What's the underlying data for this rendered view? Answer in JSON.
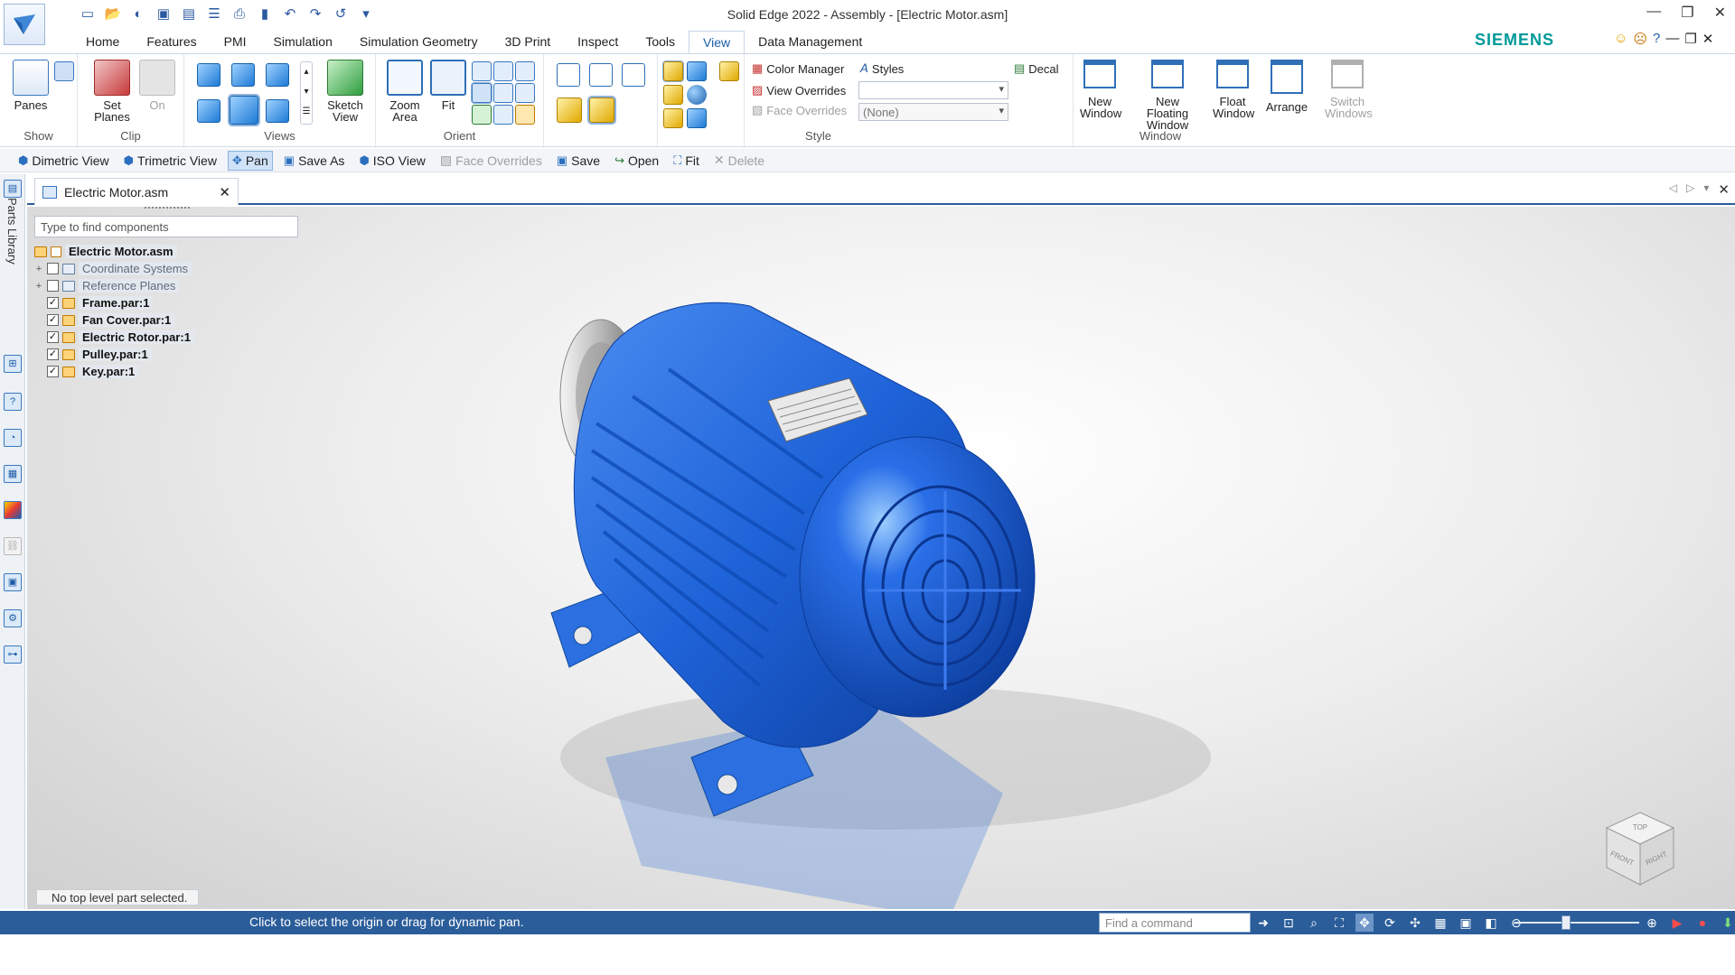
{
  "window": {
    "title": "Solid Edge 2022 - Assembly - [Electric Motor.asm]",
    "brand": "SIEMENS"
  },
  "tabs": [
    "Home",
    "Features",
    "PMI",
    "Simulation",
    "Simulation Geometry",
    "3D Print",
    "Inspect",
    "Tools",
    "View",
    "Data Management"
  ],
  "active_tab": "View",
  "ribbon": {
    "show": {
      "label": "Show",
      "panes": "Panes"
    },
    "clip": {
      "label": "Clip",
      "set_planes": "Set Planes",
      "on": "On"
    },
    "views": {
      "label": "Views",
      "sketch_view": "Sketch View"
    },
    "orient": {
      "label": "Orient",
      "zoom_area": "Zoom Area",
      "fit": "Fit"
    },
    "style": {
      "label": "Style",
      "color_manager": "Color Manager",
      "styles": "Styles",
      "view_overrides": "View Overrides",
      "face_overrides": "Face Overrides",
      "face_overrides_value": "(None)",
      "decal": "Decal"
    },
    "window": {
      "label": "Window",
      "new_window": "New Window",
      "new_floating_window": "New Floating Window",
      "float_window": "Float Window",
      "arrange": "Arrange",
      "switch_windows": "Switch Windows"
    }
  },
  "command_bar": {
    "dimetric": "Dimetric View",
    "trimetric": "Trimetric View",
    "pan": "Pan",
    "save_as": "Save As",
    "iso": "ISO View",
    "face_overrides": "Face Overrides",
    "save": "Save",
    "open": "Open",
    "fit": "Fit",
    "delete": "Delete"
  },
  "left_bar": {
    "parts_library": "Parts Library"
  },
  "document_tab": {
    "label": "Electric Motor.asm"
  },
  "pathfinder": {
    "search_placeholder": "Type to find components",
    "root": "Electric Motor.asm",
    "items": [
      {
        "label": "Coordinate Systems",
        "checked": false,
        "expandable": true
      },
      {
        "label": "Reference Planes",
        "checked": false,
        "expandable": true
      },
      {
        "label": "Frame.par:1",
        "checked": true,
        "expandable": false
      },
      {
        "label": "Fan Cover.par:1",
        "checked": true,
        "expandable": false
      },
      {
        "label": "Electric Rotor.par:1",
        "checked": true,
        "expandable": false
      },
      {
        "label": "Pulley.par:1",
        "checked": true,
        "expandable": false
      },
      {
        "label": "Key.par:1",
        "checked": true,
        "expandable": false
      }
    ]
  },
  "view_cube": {
    "top": "TOP",
    "front": "FRONT",
    "right": "RIGHT"
  },
  "status": {
    "selection_message": "No top level part selected.",
    "prompt": "Click to select the origin or drag for dynamic pan.",
    "find_command_placeholder": "Find a command"
  },
  "colors": {
    "accent": "#2b5d9a",
    "motor_blue": "#1f63d9",
    "brand": "#009999"
  }
}
